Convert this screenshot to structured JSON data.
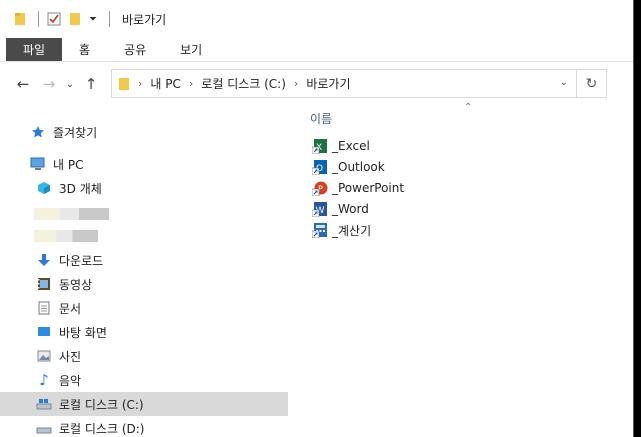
{
  "titlebar": {
    "title": "바로가기"
  },
  "ribbon": {
    "tabs": [
      "파일",
      "홈",
      "공유",
      "보기"
    ]
  },
  "address": {
    "crumbs": [
      "내 PC",
      "로컬 디스크 (C:)",
      "바로가기"
    ]
  },
  "navpane": {
    "items": [
      {
        "label": "즐겨찾기",
        "icon": "star-icon"
      },
      {
        "label": "내 PC",
        "icon": "computer-icon"
      },
      {
        "label": "3D 개체",
        "icon": "cube-3d-icon"
      },
      {
        "label": "다운로드",
        "icon": "download-icon"
      },
      {
        "label": "동영상",
        "icon": "video-icon"
      },
      {
        "label": "문서",
        "icon": "document-icon"
      },
      {
        "label": "바탕 화면",
        "icon": "desktop-icon"
      },
      {
        "label": "사진",
        "icon": "pictures-icon"
      },
      {
        "label": "음악",
        "icon": "music-icon"
      },
      {
        "label": "로컬 디스크 (C:)",
        "icon": "drive-icon"
      },
      {
        "label": "로컬 디스크 (D:)",
        "icon": "drive-icon"
      }
    ]
  },
  "content": {
    "column_name": "이름",
    "files": [
      {
        "name": "_Excel",
        "icon": "excel-shortcut-icon",
        "color": "#1e7145"
      },
      {
        "name": "_Outlook",
        "icon": "outlook-shortcut-icon",
        "color": "#0a64ad"
      },
      {
        "name": "_PowerPoint",
        "icon": "powerpoint-shortcut-icon",
        "color": "#d04423"
      },
      {
        "name": "_Word",
        "icon": "word-shortcut-icon",
        "color": "#2b579a"
      },
      {
        "name": "_계산기",
        "icon": "calculator-shortcut-icon",
        "color": "#2b6cb0"
      }
    ]
  }
}
